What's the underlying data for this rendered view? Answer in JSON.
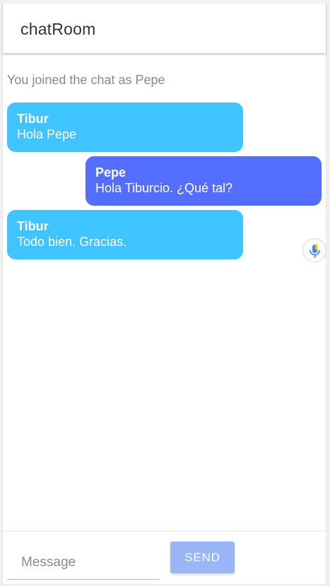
{
  "header": {
    "title": "chatRoom"
  },
  "notice": "You joined the chat as Pepe",
  "messages": [
    {
      "sender": "Tibur",
      "text": "Hola Pepe",
      "side": "other"
    },
    {
      "sender": "Pepe",
      "text": "Hola Tiburcio. ¿Qué tal?",
      "side": "self"
    },
    {
      "sender": "Tibur",
      "text": "Todo bien. Gracias.",
      "side": "other"
    }
  ],
  "composer": {
    "placeholder": "Message",
    "value": "",
    "send_label": "SEND"
  },
  "icons": {
    "voice": "microphone-icon"
  },
  "colors": {
    "other_bubble": "#40c4ff",
    "self_bubble": "#536dfe",
    "send_button": "#9ab5f8"
  }
}
